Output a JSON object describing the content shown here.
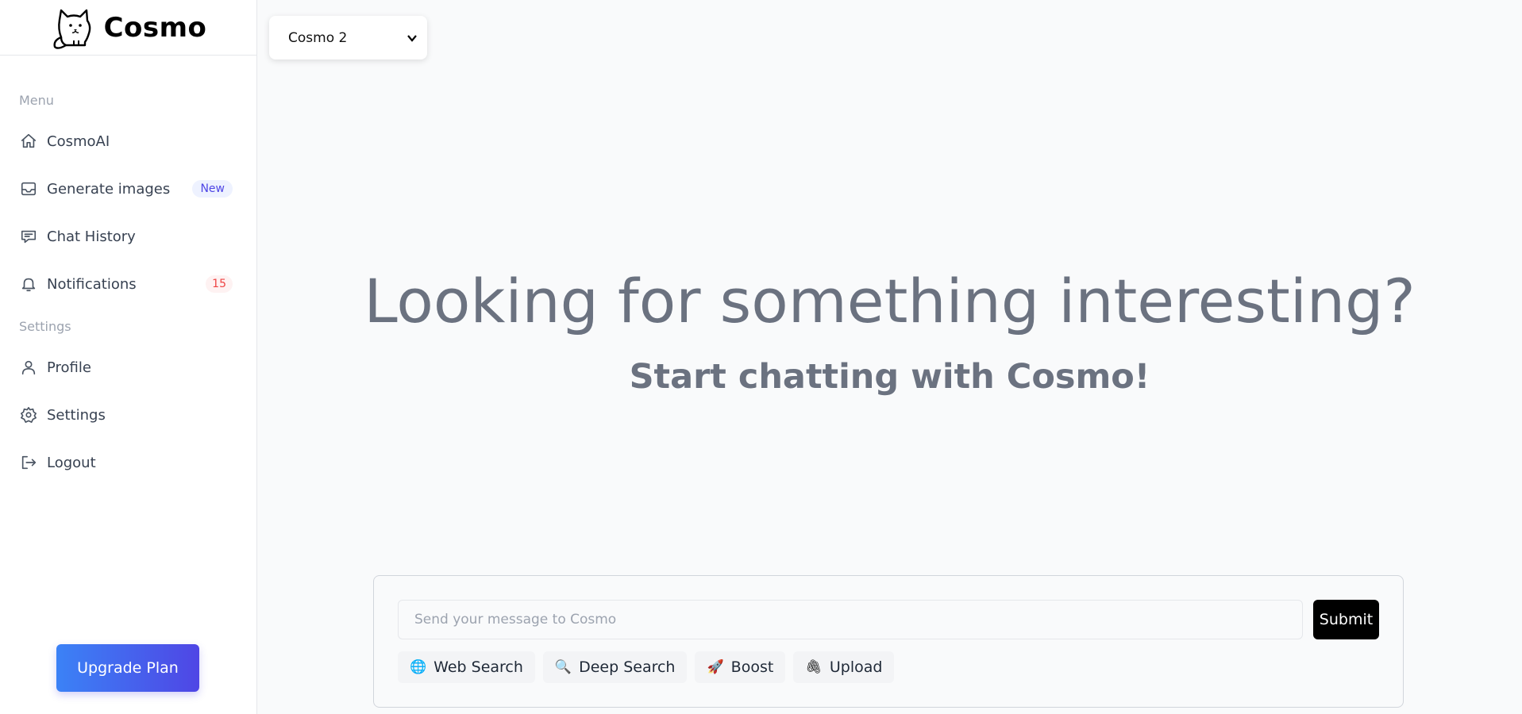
{
  "brand": {
    "name": "Cosmo"
  },
  "sidebar": {
    "menu_label": "Menu",
    "settings_label": "Settings",
    "items": [
      {
        "label": "CosmoAI",
        "icon": "home-icon"
      },
      {
        "label": "Generate images",
        "icon": "inbox-icon",
        "badge": "New"
      },
      {
        "label": "Chat History",
        "icon": "chat-icon"
      },
      {
        "label": "Notifications",
        "icon": "bell-icon",
        "count": "15"
      }
    ],
    "settings_items": [
      {
        "label": "Profile",
        "icon": "user-icon"
      },
      {
        "label": "Settings",
        "icon": "gear-icon"
      },
      {
        "label": "Logout",
        "icon": "logout-icon"
      }
    ],
    "upgrade_label": "Upgrade Plan"
  },
  "header": {
    "model": "Cosmo 2"
  },
  "hero": {
    "title": "Looking for something interesting?",
    "subtitle": "Start chatting with Cosmo!"
  },
  "composer": {
    "placeholder": "Send your message to Cosmo",
    "value": "",
    "submit_label": "Submit",
    "tools": [
      {
        "label": "Web Search",
        "emoji": "🌐",
        "icon": "globe-icon"
      },
      {
        "label": "Deep Search",
        "emoji": "🔍",
        "icon": "magnifier-icon"
      },
      {
        "label": "Boost",
        "emoji": "🚀",
        "icon": "rocket-icon"
      },
      {
        "label": "Upload",
        "emoji": "🖇",
        "icon": "paperclip-icon"
      }
    ]
  },
  "colors": {
    "accent_start": "#3b82f6",
    "accent_end": "#4f46e5",
    "new_badge": "#4f46e5",
    "count_badge": "#ef4444"
  }
}
